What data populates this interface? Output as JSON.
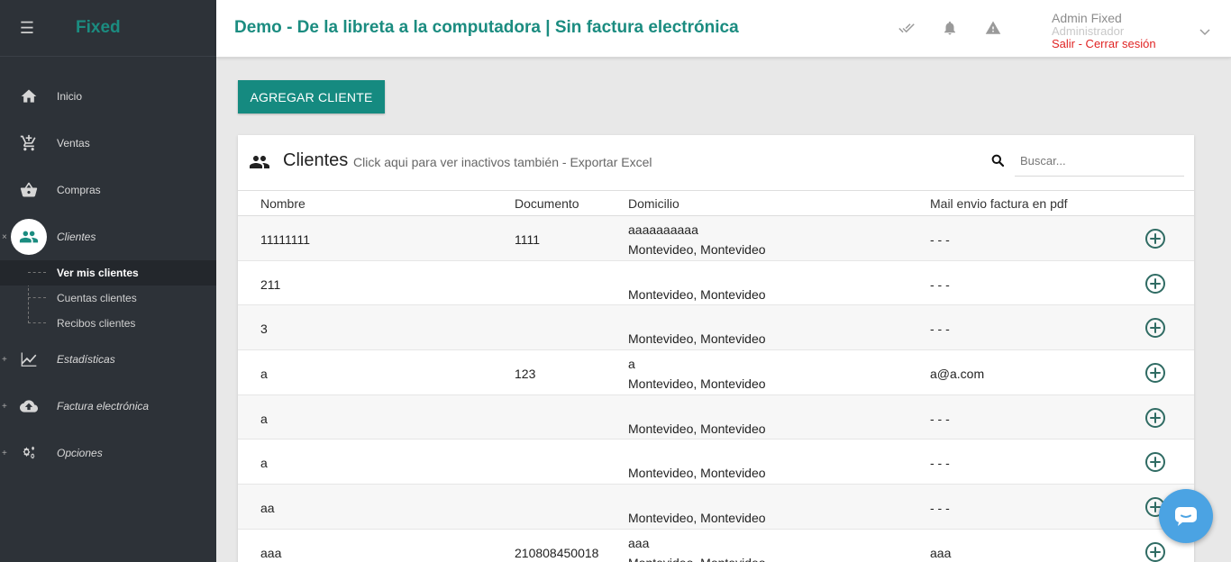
{
  "sidebar": {
    "brand": "Fixed",
    "items": [
      {
        "label": "Inicio",
        "icon": "home-icon"
      },
      {
        "label": "Ventas",
        "icon": "cart-icon"
      },
      {
        "label": "Compras",
        "icon": "basket-icon"
      },
      {
        "label": "Clientes",
        "icon": "people-icon"
      },
      {
        "label": "Estadísticas",
        "icon": "chart-icon"
      },
      {
        "label": "Factura electrónica",
        "icon": "cloud-upload-icon"
      },
      {
        "label": "Opciones",
        "icon": "gears-icon"
      }
    ],
    "sub_items": [
      {
        "label": "Ver mis clientes"
      },
      {
        "label": "Cuentas clientes"
      },
      {
        "label": "Recibos clientes"
      }
    ],
    "collapse_mark": "×",
    "expand_mark": "+"
  },
  "topbar": {
    "title": "Demo - De la libreta a la computadora | Sin factura electrónica",
    "user_name": "Admin Fixed",
    "user_role": "Administrador",
    "logout": "Salir - Cerrar sesión"
  },
  "add_button": "AGREGAR CLIENTE",
  "card": {
    "title": "Clientes",
    "inactive_link": "Click aqui para ver inactivos también",
    "separator": " - ",
    "export_link": "Exportar Excel",
    "search_placeholder": "Buscar..."
  },
  "table": {
    "headers": [
      "Nombre",
      "Documento",
      "Domicilio",
      "Mail envio factura en pdf"
    ],
    "rows": [
      {
        "name": "11111111",
        "doc": "1111",
        "addr1": "aaaaaaaaaa",
        "addr2": "Montevideo, Montevideo",
        "mail": "- - -"
      },
      {
        "name": "211",
        "doc": "",
        "addr1": "",
        "addr2": "Montevideo, Montevideo",
        "mail": "- - -"
      },
      {
        "name": "3",
        "doc": "",
        "addr1": "",
        "addr2": "Montevideo, Montevideo",
        "mail": "- - -"
      },
      {
        "name": "a",
        "doc": "123",
        "addr1": "a",
        "addr2": "Montevideo, Montevideo",
        "mail": "a@a.com"
      },
      {
        "name": "a",
        "doc": "",
        "addr1": "",
        "addr2": "Montevideo, Montevideo",
        "mail": "- - -"
      },
      {
        "name": "a",
        "doc": "",
        "addr1": "",
        "addr2": "Montevideo, Montevideo",
        "mail": "- - -"
      },
      {
        "name": "aa",
        "doc": "",
        "addr1": "",
        "addr2": "Montevideo, Montevideo",
        "mail": "- - -"
      },
      {
        "name": "aaa",
        "doc": "210808450018",
        "addr1": "aaa",
        "addr2": "Montevideo, Montevideo",
        "mail": "aaa"
      }
    ]
  },
  "colors": {
    "accent": "#1b8c80",
    "sidebar_bg": "#2d3238",
    "logout": "#e02424",
    "chat": "#4ba3e3"
  }
}
